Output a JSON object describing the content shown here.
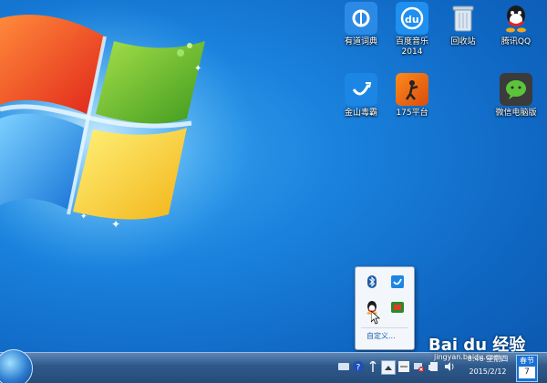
{
  "desktop": {
    "icons": [
      {
        "label": "有道词典",
        "icon": "youdao-dict-icon"
      },
      {
        "label": "百度音乐\n2014",
        "icon": "baidu-music-icon"
      },
      {
        "label": "回收站",
        "icon": "recycle-bin-icon"
      },
      {
        "label": "腾讯QQ",
        "icon": "qq-icon"
      },
      {
        "label": "金山毒霸",
        "icon": "kingsoft-antivirus-icon"
      },
      {
        "label": "175平台",
        "icon": "175-platform-icon"
      },
      {
        "label": "微信电脑版",
        "icon": "wechat-pc-icon"
      }
    ]
  },
  "tray_popup": {
    "items": [
      "bluetooth-icon",
      "kingsoft-tray-icon",
      "qq-tray-icon",
      "green-app-tray-icon"
    ],
    "customize_label": "自定义..."
  },
  "taskbar": {
    "clock_time": "8:46 星期四",
    "clock_date": "2015/2/12",
    "calendar_top": "春节",
    "calendar_day": "7"
  },
  "watermark": {
    "brand": "Bai du 经验",
    "url": "jingyan.baidu.com"
  },
  "colors": {
    "desktop_blue": "#1a82dd",
    "taskbar": "#2f5a8c",
    "link_blue": "#1a5fb4"
  }
}
